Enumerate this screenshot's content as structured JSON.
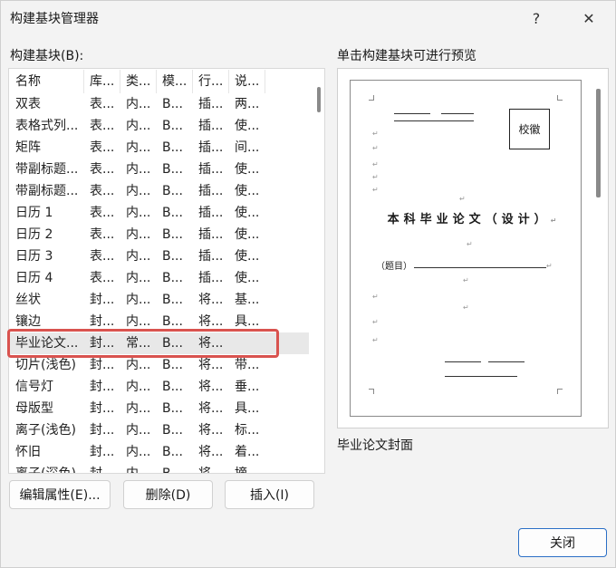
{
  "window": {
    "title": "构建基块管理器",
    "help_glyph": "?",
    "close_glyph": "✕"
  },
  "left_label": "构建基块(B):",
  "right_label": "单击构建基块可进行预览",
  "table": {
    "headers": [
      "名称",
      "库...",
      "类...",
      "模...",
      "行...",
      "说..."
    ],
    "rows": [
      [
        "双表",
        "表...",
        "内...",
        "B...",
        "插...",
        "两..."
      ],
      [
        "表格式列...",
        "表...",
        "内...",
        "B...",
        "插...",
        "使..."
      ],
      [
        "矩阵",
        "表...",
        "内...",
        "B...",
        "插...",
        "间..."
      ],
      [
        "带副标题...",
        "表...",
        "内...",
        "B...",
        "插...",
        "使..."
      ],
      [
        "带副标题...",
        "表...",
        "内...",
        "B...",
        "插...",
        "使..."
      ],
      [
        "日历 1",
        "表...",
        "内...",
        "B...",
        "插...",
        "使..."
      ],
      [
        "日历 2",
        "表...",
        "内...",
        "B...",
        "插...",
        "使..."
      ],
      [
        "日历 3",
        "表...",
        "内...",
        "B...",
        "插...",
        "使..."
      ],
      [
        "日历 4",
        "表...",
        "内...",
        "B...",
        "插...",
        "使..."
      ],
      [
        "丝状",
        "封...",
        "内...",
        "B...",
        "将...",
        "基..."
      ],
      [
        "镶边",
        "封...",
        "内...",
        "B...",
        "将...",
        "具..."
      ],
      [
        "毕业论文...",
        "封...",
        "常...",
        "B...",
        "将...",
        ""
      ],
      [
        "切片(浅色)",
        "封...",
        "内...",
        "B...",
        "将...",
        "带..."
      ],
      [
        "信号灯",
        "封...",
        "内...",
        "B...",
        "将...",
        "垂..."
      ],
      [
        "母版型",
        "封...",
        "内...",
        "B...",
        "将...",
        "具..."
      ],
      [
        "离子(浅色)",
        "封...",
        "内...",
        "B...",
        "将...",
        "标..."
      ],
      [
        "怀旧",
        "封...",
        "内...",
        "B...",
        "将...",
        "着..."
      ],
      [
        "离子(深色)",
        "封...",
        "内...",
        "B...",
        "将...",
        "摘..."
      ]
    ],
    "selected_index": 11
  },
  "buttons": {
    "edit": "编辑属性(E)...",
    "delete": "删除(D)",
    "insert": "插入(I)",
    "close": "关闭"
  },
  "preview": {
    "seal": "校徽",
    "heading": "本科毕业论文（设计）",
    "topic_label": "（题目）",
    "caption": "毕业论文封面",
    "return_mark": "↵"
  }
}
